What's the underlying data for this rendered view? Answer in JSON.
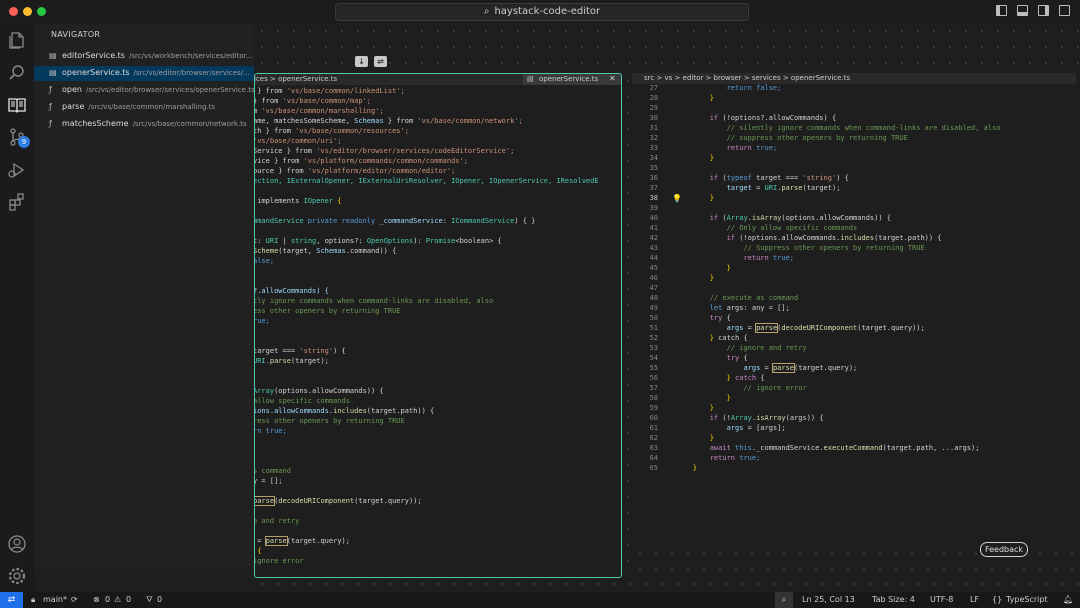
{
  "window": {
    "title": "haystack-code-editor"
  },
  "activity_bar": {
    "scm_badge": "9"
  },
  "navigator": {
    "title": "NAVIGATOR",
    "items": [
      {
        "name": "editorService.ts",
        "path": "/src/vs/workbench/services/editor...",
        "icon": "file-icon"
      },
      {
        "name": "openerService.ts",
        "path": "/src/vs/editor/browser/services/...",
        "icon": "file-icon",
        "selected": true
      },
      {
        "name": "open",
        "path": "/src/vs/editor/browser/services/openerService.ts",
        "icon": "function-icon"
      },
      {
        "name": "parse",
        "path": "/src/vs/base/common/marshalling.ts",
        "icon": "function-icon"
      },
      {
        "name": "matchesScheme",
        "path": "/src/vs/base/common/network.ts",
        "icon": "function-icon"
      }
    ]
  },
  "left_editor": {
    "breadcrumb": "ices > openerService.ts",
    "tab_label": "openerService.ts",
    "close_glyph": "✕",
    "nav_buttons": [
      "↓",
      "⇌"
    ]
  },
  "right_editor": {
    "breadcrumb": "src > vs > editor > browser > services > openerService.ts",
    "first_line_number": 27,
    "current_line": 38
  },
  "diff_buttons": [
    "←",
    "→"
  ],
  "feedback_label": "Feedback",
  "status_bar": {
    "branch": "main*",
    "errors": "0",
    "warnings": "0",
    "ports": "0",
    "cursor": "Ln 25, Col 13",
    "tab_size": "Tab Size: 4",
    "encoding": "UTF-8",
    "eol": "LF",
    "language": "TypeScript"
  },
  "colors": {
    "accent": "#4ec9b0",
    "selection": "#04395e",
    "remote": "#1f6feb"
  }
}
